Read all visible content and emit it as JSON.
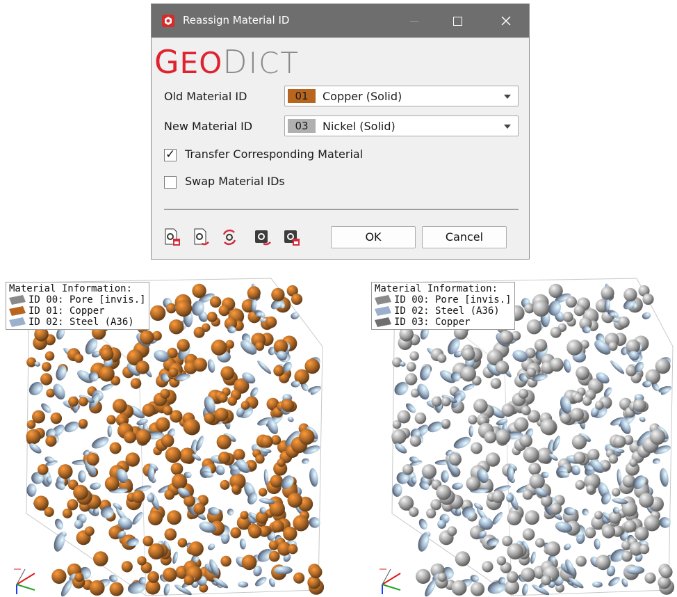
{
  "dialog": {
    "title": "Reassign Material ID",
    "logo": {
      "geo_first": "G",
      "geo_rest": "EO",
      "dict_first": "D",
      "dict_rest": "ICT"
    },
    "old_label": "Old Material ID",
    "old_select": {
      "id": "01",
      "name": "Copper (Solid)",
      "color": "#b8651f"
    },
    "new_label": "New Material ID",
    "new_select": {
      "id": "03",
      "name": "Nickel (Solid)",
      "color": "#b0b0b0"
    },
    "transfer_label": "Transfer Corresponding Material",
    "transfer_checked": true,
    "swap_label": "Swap Material IDs",
    "swap_checked": false,
    "ok_label": "OK",
    "cancel_label": "Cancel"
  },
  "views": [
    {
      "legend_title": "Material Information:",
      "entries": [
        {
          "text": "ID 00: Pore [invis.]",
          "color": "#8a8a8a"
        },
        {
          "text": "ID 01: Copper",
          "color": "#b8651f"
        },
        {
          "text": "ID 02: Steel (A36)",
          "color": "#9ab0cc"
        }
      ],
      "particle_color": "#b06a28",
      "fiber_color": "#9fb4cf"
    },
    {
      "legend_title": "Material Information:",
      "entries": [
        {
          "text": "ID 00: Pore [invis.]",
          "color": "#8a8a8a"
        },
        {
          "text": "ID 02: Steel (A36)",
          "color": "#9ab0cc"
        },
        {
          "text": "ID 03: Copper",
          "color": "#6f6f6f"
        }
      ],
      "particle_color": "#a9a9a9",
      "fiber_color": "#9fb4cf"
    }
  ]
}
